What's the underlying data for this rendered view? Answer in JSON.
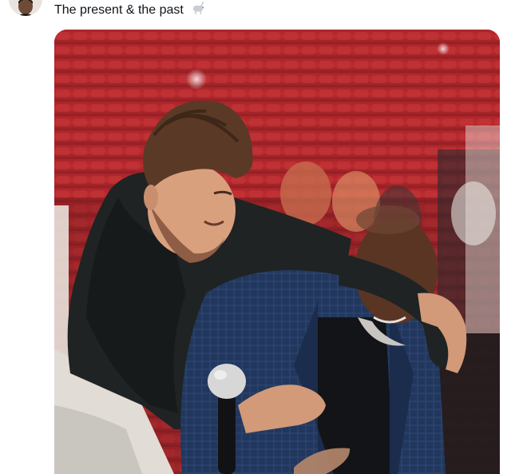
{
  "post": {
    "text": "The present & the past",
    "emoji_icon": "goat-icon"
  },
  "author": {
    "avatar_icon": "profile-avatar"
  },
  "media": {
    "type": "photo",
    "colors": {
      "seats": "#b3262a",
      "hoodie": "#1f2323",
      "blazer": "#243a63",
      "skin_light": "#d9a07e",
      "skin_dark": "#5a3524"
    }
  }
}
